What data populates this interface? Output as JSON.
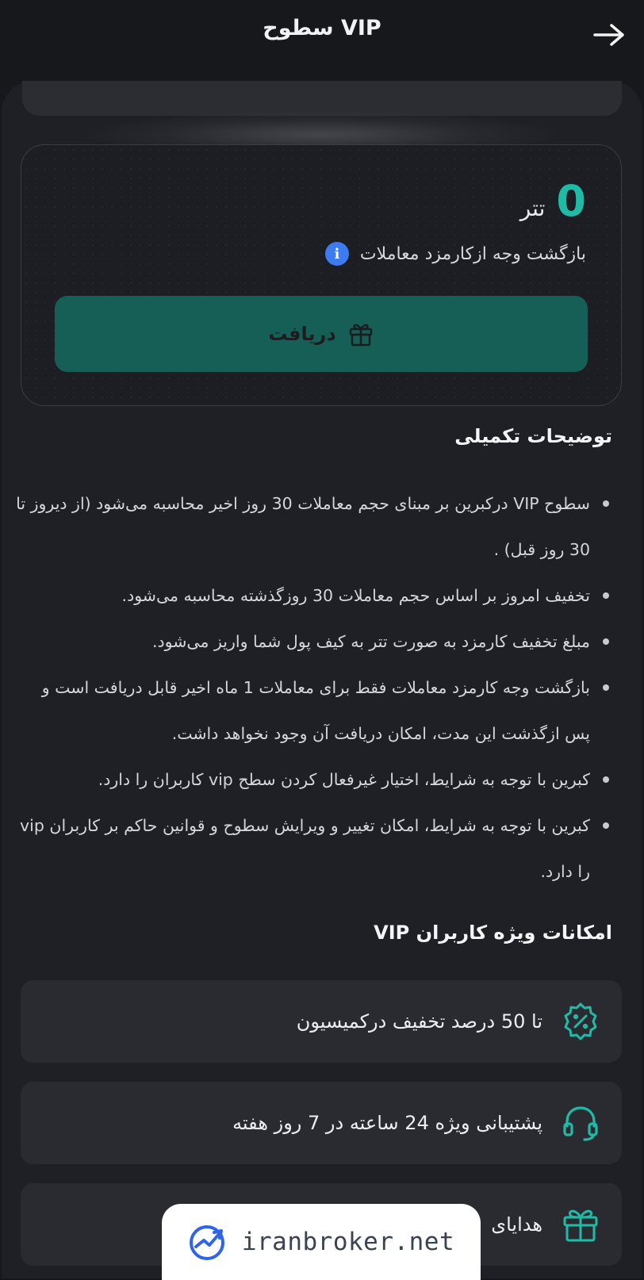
{
  "header": {
    "title": "سطوح VIP",
    "back_icon": "arrow-right-icon"
  },
  "cashback": {
    "amount": "0",
    "unit": "تتر",
    "label": "بازگشت وجه ازکارمزد معاملات",
    "info_icon": "info-icon",
    "claim_label": "دریافت",
    "claim_icon": "gift-icon",
    "accent_color": "#1fbba6",
    "button_color": "#155f56"
  },
  "notes": {
    "heading": "توضیحات تکمیلی",
    "items": [
      "سطوح VIP درکبرین بر مبنای حجم معاملات 30 روز اخیر محاسبه می‌شود (از دیروز تا 30 روز قبل) .",
      "تخفیف امروز بر اساس حجم معاملات 30 روزگذشته محاسبه می‌شود.",
      "مبلغ تخفیف کارمزد به صورت تتر به کیف پول شما واریز می‌شود.",
      "بازگشت وجه کارمزد معاملات فقط برای معاملات 1 ماه اخیر قابل دریافت است و پس ازگذشت این مدت، امکان دریافت آن وجود نخواهد داشت.",
      "کبرین با توجه به شرایط، اختیار غیرفعال کردن سطح vip کاربران را دارد.",
      "کبرین با توجه به شرایط، امکان تغییر و ویرایش سطوح و قوانین حاکم بر کاربران vip را دارد."
    ]
  },
  "features": {
    "heading": "امکانات ویژه کاربران VIP",
    "items": [
      {
        "label": "تا 50 درصد تخفیف درکمیسیون",
        "icon": "discount-badge-icon"
      },
      {
        "label": "پشتیبانی ویژه 24 ساعته در 7 روز هفته",
        "icon": "headset-icon"
      },
      {
        "label": "هدایای",
        "icon": "gift-icon"
      }
    ]
  },
  "watermark": {
    "text": "iranbroker.net",
    "icon": "trend-chart-logo-icon"
  }
}
